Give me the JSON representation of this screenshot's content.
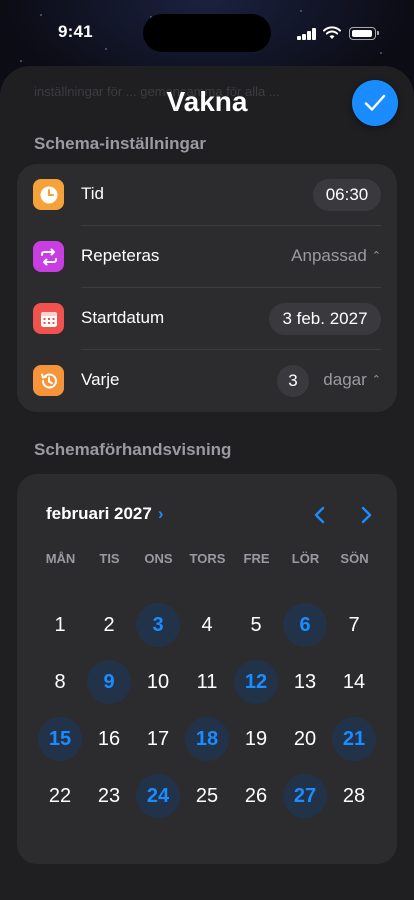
{
  "status_bar": {
    "time": "9:41"
  },
  "sheet": {
    "ghost_text": "inställningar för ... gemensamma för alla ...",
    "title": "Vakna",
    "done_icon": "checkmark-icon"
  },
  "schedule_settings": {
    "heading": "Schema-inställningar",
    "rows": [
      {
        "label": "Tid",
        "value": "06:30",
        "icon": "clock-icon",
        "icon_color": "#f5a23a"
      },
      {
        "label": "Repeteras",
        "value": "Anpassad",
        "icon": "repeat-icon",
        "icon_color": "#c83ee0"
      },
      {
        "label": "Startdatum",
        "value": "3 feb. 2027",
        "icon": "calendar-icon",
        "icon_color": "#f0524d"
      },
      {
        "label": "Varje",
        "value_number": "3",
        "value_unit": "dagar",
        "icon": "history-icon",
        "icon_color": "#f5943a"
      }
    ]
  },
  "preview": {
    "heading": "Schemaförhandsvisning",
    "month_label": "februari 2027",
    "weekdays": [
      "MÅN",
      "TIS",
      "ONS",
      "TORS",
      "FRE",
      "LÖR",
      "SÖN"
    ],
    "weeks": [
      [
        "1",
        "2",
        "3",
        "4",
        "5",
        "6",
        "7"
      ],
      [
        "8",
        "9",
        "10",
        "11",
        "12",
        "13",
        "14"
      ],
      [
        "15",
        "16",
        "17",
        "18",
        "19",
        "20",
        "21"
      ],
      [
        "22",
        "23",
        "24",
        "25",
        "26",
        "27",
        "28"
      ]
    ],
    "selected_days": [
      "3",
      "6",
      "9",
      "12",
      "15",
      "18",
      "21",
      "24",
      "27"
    ]
  },
  "colors": {
    "accent": "#1a8cff",
    "sheet_bg": "#1f1f22",
    "card_bg": "#2c2c2f"
  }
}
